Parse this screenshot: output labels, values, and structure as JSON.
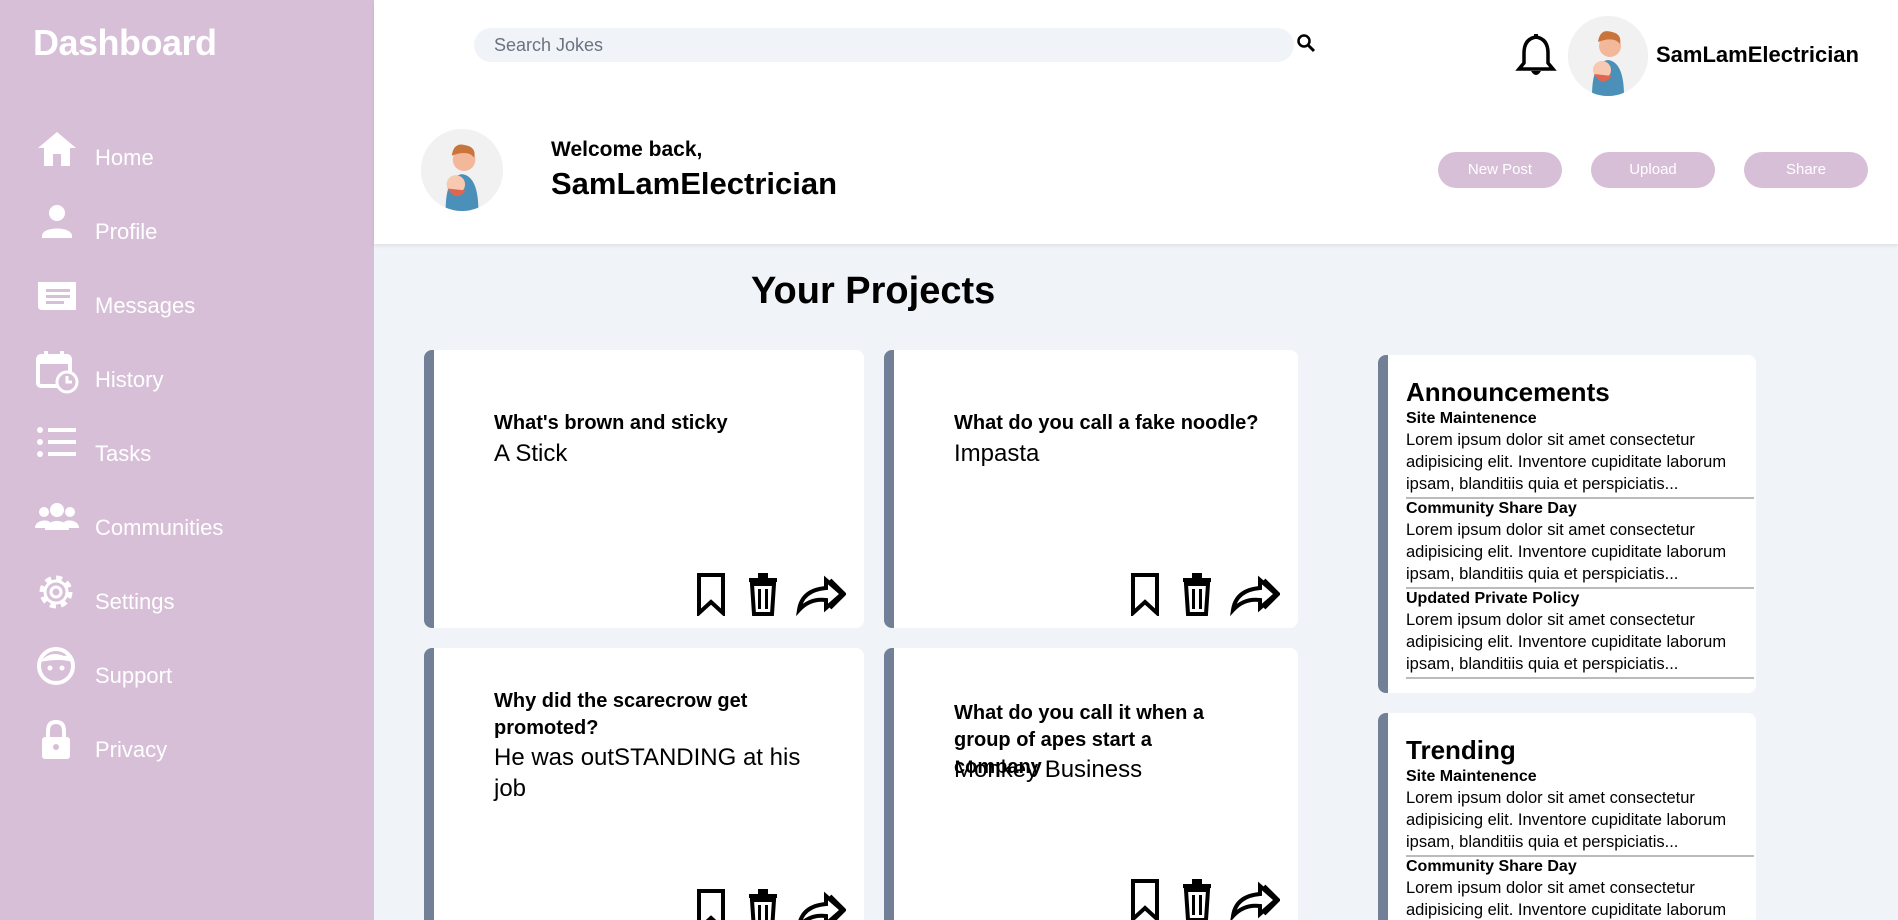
{
  "sidebar": {
    "title": "Dashboard",
    "items": [
      {
        "label": "Home",
        "icon": "home-icon"
      },
      {
        "label": "Profile",
        "icon": "user-icon"
      },
      {
        "label": "Messages",
        "icon": "messages-icon"
      },
      {
        "label": "History",
        "icon": "calendar-clock-icon"
      },
      {
        "label": "Tasks",
        "icon": "list-icon"
      },
      {
        "label": "Communities",
        "icon": "people-icon"
      },
      {
        "label": "Settings",
        "icon": "gear-icon"
      },
      {
        "label": "Support",
        "icon": "face-icon"
      },
      {
        "label": "Privacy",
        "icon": "lock-icon"
      }
    ]
  },
  "header": {
    "search_placeholder": "Search Jokes",
    "username": "SamLamElectrician",
    "welcome": "Welcome back,",
    "welcome_name": "SamLamElectrician",
    "buttons": {
      "new_post": "New Post",
      "upload": "Upload",
      "share": "Share"
    }
  },
  "projects": {
    "title": "Your Projects",
    "cards": [
      {
        "question": "What's brown and sticky",
        "answer": "A Stick"
      },
      {
        "question": "What do you call a fake noodle?",
        "answer": "Impasta"
      },
      {
        "question": "Why did the scarecrow get promoted?",
        "answer": "He was outSTANDING at his job"
      },
      {
        "question": "What do you call it when a group of apes start a company",
        "answer": "Monkey Business"
      }
    ]
  },
  "announcements": {
    "title": "Announcements",
    "items": [
      {
        "heading": "Site Maintenence",
        "text": "Lorem ipsum dolor sit amet consectetur adipisicing elit. Inventore cupiditate laborum ipsam, blanditiis quia et perspiciatis..."
      },
      {
        "heading": "Community Share Day",
        "text": "Lorem ipsum dolor sit amet consectetur adipisicing elit. Inventore cupiditate laborum ipsam, blanditiis quia et perspiciatis..."
      },
      {
        "heading": "Updated Private Policy",
        "text": "Lorem ipsum dolor sit amet consectetur adipisicing elit. Inventore cupiditate laborum ipsam, blanditiis quia et perspiciatis..."
      }
    ]
  },
  "trending": {
    "title": "Trending",
    "items": [
      {
        "heading": "Site Maintenence",
        "text": "Lorem ipsum dolor sit amet consectetur adipisicing elit. Inventore cupiditate laborum ipsam, blanditiis quia et perspiciatis..."
      },
      {
        "heading": "Community Share Day",
        "text": "Lorem ipsum dolor sit amet consectetur adipisicing elit. Inventore cupiditate laborum ipsam, blanditiis quia et perspiciatis..."
      }
    ]
  },
  "colors": {
    "sidebar": "#d8bfd8",
    "accent_border": "#718096",
    "background": "#f0f4f8"
  }
}
